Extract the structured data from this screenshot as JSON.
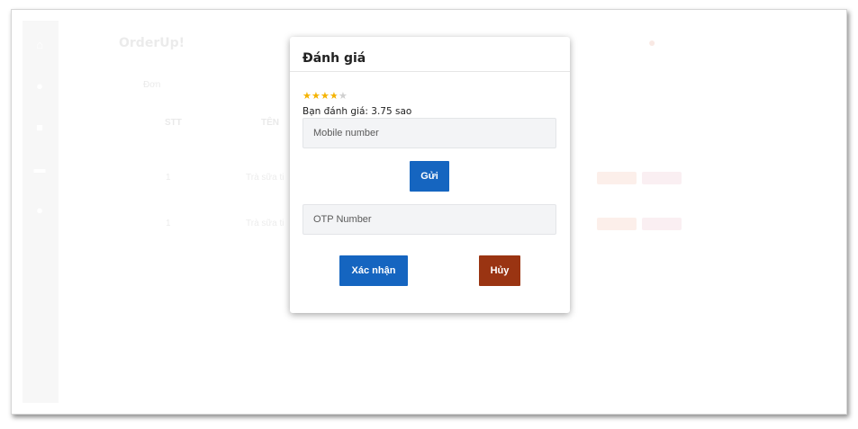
{
  "app": {
    "brand": "OrderUp!",
    "breadcrumb": "Đơn",
    "table_headers": [
      "STT",
      "TÊN"
    ],
    "rows": [
      {
        "stt": "1",
        "name": "Trà sữa ti"
      },
      {
        "stt": "1",
        "name": "Trà sữa ti"
      }
    ]
  },
  "modal": {
    "title": "Đánh giá",
    "rating": {
      "value": 3.75,
      "max": 5,
      "text": "Bạn đánh giá: 3.75 sao"
    },
    "mobile_placeholder": "Mobile number",
    "send_label": "Gửi",
    "otp_placeholder": "OTP Number",
    "confirm_label": "Xác nhận",
    "cancel_label": "Hủy"
  },
  "colors": {
    "primary": "#1565c0",
    "danger": "#9a3412",
    "star": "#f5b301"
  }
}
